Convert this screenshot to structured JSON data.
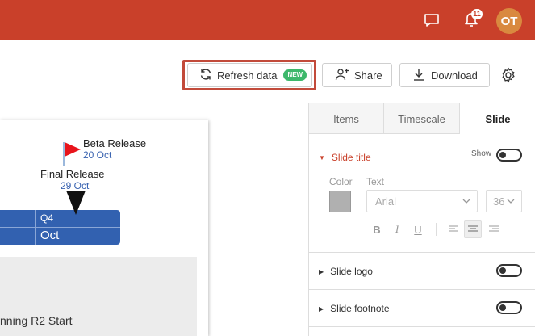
{
  "topbar": {
    "notifications_count": "11",
    "avatar_initials": "OT",
    "color": "#c9402a"
  },
  "toolbar": {
    "refresh_label": "Refresh data",
    "refresh_badge": "NEW",
    "share_label": "Share",
    "download_label": "Download"
  },
  "canvas": {
    "milestones": [
      {
        "label": "Beta Release",
        "date": "20 Oct"
      },
      {
        "label": "Final Release",
        "date": "29 Oct"
      }
    ],
    "timescale": {
      "quarter": "Q4",
      "month": "Oct"
    },
    "task_label": "nning R2 Start"
  },
  "panel": {
    "tabs": [
      "Items",
      "Timescale",
      "Slide"
    ],
    "active_tab": "Slide",
    "slide_title": {
      "label": "Slide title",
      "show_label": "Show",
      "color_label": "Color",
      "text_label": "Text",
      "font": "Arial",
      "size": "36",
      "format_buttons": [
        "B",
        "I",
        "U"
      ]
    },
    "slide_logo": {
      "label": "Slide logo"
    },
    "slide_footnote": {
      "label": "Slide footnote"
    }
  }
}
